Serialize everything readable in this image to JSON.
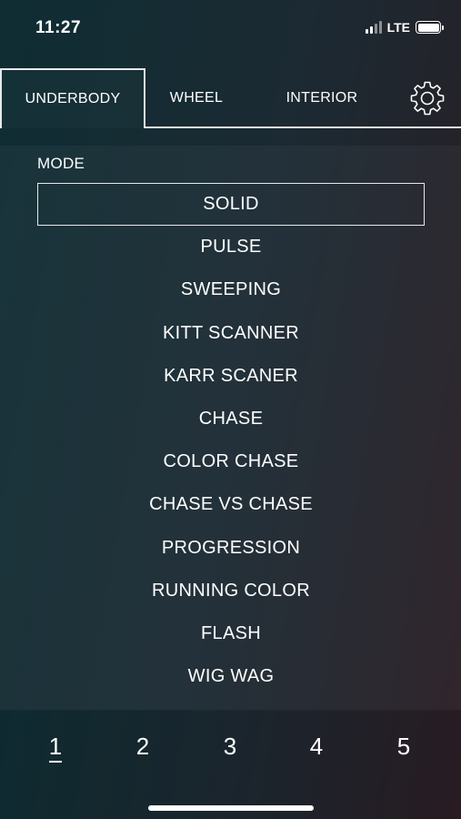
{
  "status": {
    "time": "11:27",
    "network": "LTE"
  },
  "tabs": [
    {
      "label": "UNDERBODY",
      "active": true
    },
    {
      "label": "WHEEL",
      "active": false
    },
    {
      "label": "INTERIOR",
      "active": false
    }
  ],
  "settings_icon": "gear-icon",
  "mode": {
    "label": "MODE",
    "items": [
      "SOLID",
      "PULSE",
      "SWEEPING",
      "KITT SCANNER",
      "KARR SCANER",
      "CHASE",
      "COLOR CHASE",
      "CHASE VS CHASE",
      "PROGRESSION",
      "RUNNING COLOR",
      "FLASH",
      "WIG WAG"
    ],
    "selected": "SOLID"
  },
  "pages": {
    "items": [
      "1",
      "2",
      "3",
      "4",
      "5"
    ],
    "active": "1"
  },
  "colors": {
    "accent": "#ffffff",
    "background_start": "#0f2d33",
    "background_end": "#2a1e24"
  }
}
